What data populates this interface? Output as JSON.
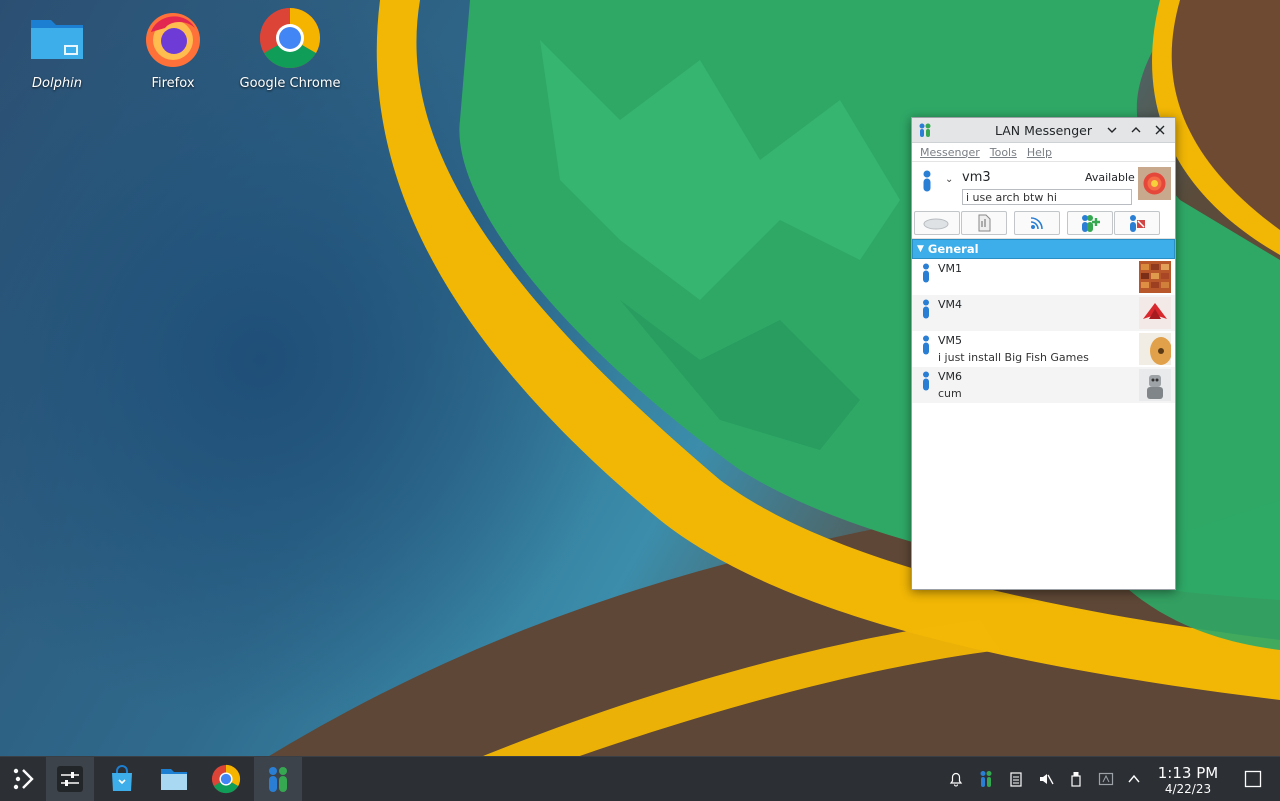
{
  "desktop": {
    "icons": [
      {
        "label": "Dolphin"
      },
      {
        "label": "Firefox"
      },
      {
        "label": "Google Chrome"
      }
    ]
  },
  "window": {
    "title": "LAN Messenger",
    "menu": [
      "Messenger",
      "Tools",
      "Help"
    ],
    "profile": {
      "username": "vm3",
      "status": "Available",
      "note": "i use arch btw hi"
    },
    "group": "General",
    "contacts": [
      {
        "name": "VM1",
        "note": ""
      },
      {
        "name": "VM4",
        "note": ""
      },
      {
        "name": "VM5",
        "note": "i just install Big Fish Games"
      },
      {
        "name": "VM6",
        "note": "cum"
      }
    ]
  },
  "taskbar": {
    "clock": {
      "time": "1:13 PM",
      "date": "4/22/23"
    },
    "apps": [
      "app-launcher",
      "system-settings",
      "discover",
      "dolphin",
      "google-chrome",
      "lan-messenger"
    ],
    "tray": [
      "notifications",
      "lan-messenger",
      "clipboard",
      "volume-muted",
      "usb-device",
      "keyboard-layout",
      "show-hidden"
    ]
  },
  "colors": {
    "accent": "#3daee9",
    "taskbar": "#2c3035",
    "green_floor": "#2fa866",
    "ring_gold": "#f2b705"
  }
}
